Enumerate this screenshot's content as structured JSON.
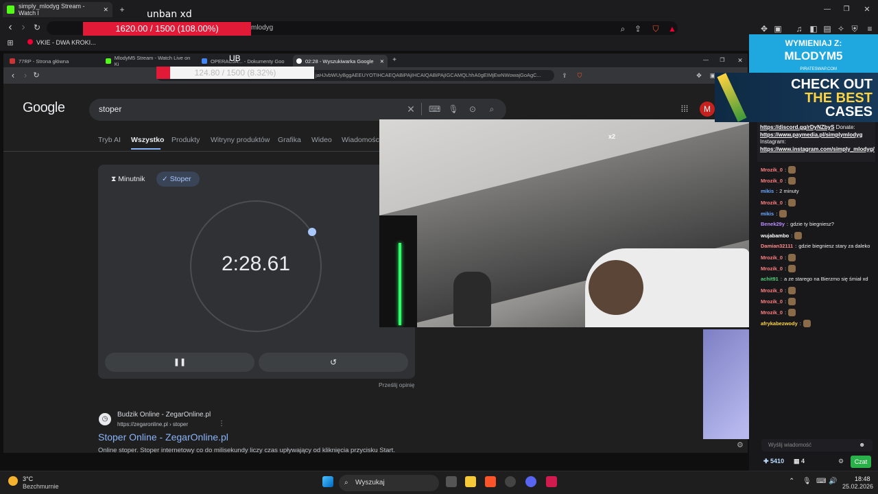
{
  "overlay": {
    "top_text": "unban xd",
    "goal_bar": "1620.00 / 1500 (108.00%)",
    "goal_fraction": 1.0,
    "inner_goal_bar": "124.80 / 1500 (8.32%)",
    "inner_goal_fraction": 0.0832,
    "inner_letters": "UB"
  },
  "outer_browser": {
    "tab_title": "simply_mlodyg Stream - Watch l",
    "url": "mlodyg",
    "bookmark": "VKIE - DWA KROKI..."
  },
  "inner_browser": {
    "tabs": [
      {
        "label": "77RP - Strona główna"
      },
      {
        "label": "MlodyM5 Stream - Watch Live on Ki"
      },
      {
        "label": "OPERACJA... - Dokumenty Goo"
      },
      {
        "label": "02:28 - Wyszukiwarka Google"
      }
    ],
    "url": "jaHJvbWUyBggAEEUYOTIHCAEQABiPAjIHCAIQABiPAjIGCAMQLhhA0gEIMjEwNWowajGoAgC..."
  },
  "google": {
    "logo": "Google",
    "query": "stoper",
    "tabs": [
      "Tryb AI",
      "Wszystko",
      "Produkty",
      "Witryny produktów",
      "Grafika",
      "Wideo",
      "Wiadomości"
    ],
    "active_tab": "Wszystko",
    "stopwatch": {
      "timer_tab": "Minutnik",
      "stopwatch_tab": "Stoper",
      "time": "2:28.61",
      "pause_icon": "pause-icon",
      "reset_icon": "reset-icon"
    },
    "feedback": "Prześlij opinię",
    "result": {
      "site": "Budzik Online - ZegarOnline.pl",
      "url": "https://zegaronline.pl › stoper",
      "title": "Stoper Online - ZegarOnline.pl",
      "snippet": "Online stoper. Stoper internetowy co do milisekundy liczy czas upływający od kliknięcia przycisku Start."
    }
  },
  "chat": {
    "banner": {
      "line1": "WYMIENIAJ Z:",
      "line2": "MLODYM5",
      "sponsor": "PIRATESWAP.COM",
      "cases1": "CHECK OUT",
      "cases2": "THE BEST",
      "cases3": "CASES"
    },
    "pinned": {
      "link1": "https://discord.gg/rDyNZbyS",
      "donate": " Donate:",
      "link2": "https://www.paymedia.pl/simplymlodyg",
      "instagram": "Instagram:",
      "link3": "https://www.instagram.com/simply_mlodyg/"
    },
    "messages": [
      {
        "user": "Mrozik_0",
        "color": "#ff7f7f",
        "text": ""
      },
      {
        "user": "Mrozik_0",
        "color": "#ff7f7f",
        "text": ""
      },
      {
        "user": "mikis",
        "color": "#6aa8ff",
        "text": "2 minuty"
      },
      {
        "user": "Mrozik_0",
        "color": "#ff7f7f",
        "text": ""
      },
      {
        "user": "mikis",
        "color": "#6aa8ff",
        "text": ""
      },
      {
        "user": "Benek29y",
        "color": "#b98cff",
        "text": "gdzie ty biegniesz?"
      },
      {
        "user": "wujabambo",
        "color": "#ffffff",
        "text": ""
      },
      {
        "user": "Damian32111",
        "color": "#ff8a8a",
        "text": "gdzie biegniesz stary za daleko"
      },
      {
        "user": "Mrozik_0",
        "color": "#ff7f7f",
        "text": ""
      },
      {
        "user": "Mrozik_0",
        "color": "#ff7f7f",
        "text": ""
      },
      {
        "user": "achit91",
        "color": "#4fd27a",
        "text": "a ze starego na Bierzmo się śmiał xd"
      },
      {
        "user": "Mrozik_0",
        "color": "#ff7f7f",
        "text": ""
      },
      {
        "user": "Mrozik_0",
        "color": "#ff7f7f",
        "text": ""
      },
      {
        "user": "Mrozik_0",
        "color": "#ff7f7f",
        "text": ""
      },
      {
        "user": "afrykabezwody",
        "color": "#ffd23f",
        "text": ""
      }
    ],
    "input_placeholder": "Wyślij wiadomość",
    "points": "5410",
    "count": "4",
    "send_button": "Czat"
  },
  "room_cam": {
    "counter": "x2"
  },
  "taskbar": {
    "weather_temp": "3°C",
    "weather_desc": "Bezchmurnie",
    "search": "Wyszukaj",
    "time": "18:48",
    "date": "25.02.2026"
  }
}
